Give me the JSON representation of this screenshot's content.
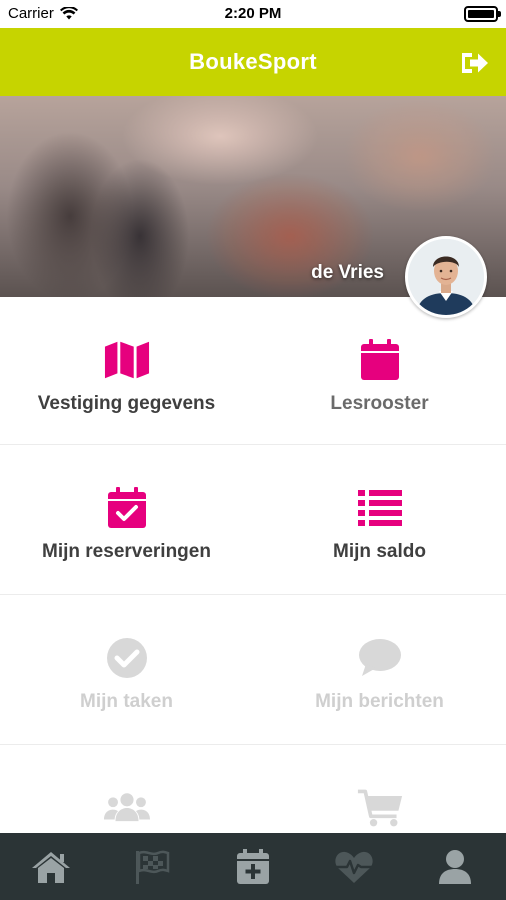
{
  "status_bar": {
    "carrier": "Carrier",
    "time": "2:20 PM"
  },
  "header": {
    "title": "BoukeSport",
    "logout_icon": "sign-out-icon"
  },
  "hero": {
    "user_name": "de Vries",
    "avatar_icon": "user-avatar"
  },
  "menu": [
    {
      "label": "Vestiging gegevens",
      "icon": "map-icon",
      "enabled": true
    },
    {
      "label": "Lesrooster",
      "icon": "calendar-icon",
      "enabled": true
    },
    {
      "label": "Mijn reserveringen",
      "icon": "calendar-check-icon",
      "enabled": true
    },
    {
      "label": "Mijn saldo",
      "icon": "list-icon",
      "enabled": true
    },
    {
      "label": "Mijn taken",
      "icon": "check-circle-icon",
      "enabled": false
    },
    {
      "label": "Mijn berichten",
      "icon": "chat-icon",
      "enabled": false
    },
    {
      "label": "",
      "icon": "users-icon",
      "enabled": false
    },
    {
      "label": "",
      "icon": "cart-icon",
      "enabled": false
    }
  ],
  "tab_bar": [
    {
      "icon": "home-icon",
      "active": true
    },
    {
      "icon": "flag-icon",
      "active": false
    },
    {
      "icon": "calendar-plus-icon",
      "active": true
    },
    {
      "icon": "heartbeat-icon",
      "active": false
    },
    {
      "icon": "user-icon",
      "active": true
    }
  ],
  "colors": {
    "header": "#c6d400",
    "accent": "#e6007e",
    "disabled": "#d8d8d8",
    "tab_bar": "#2b3436",
    "tab_active": "#9aa3a5",
    "tab_inactive": "#4d5759"
  }
}
